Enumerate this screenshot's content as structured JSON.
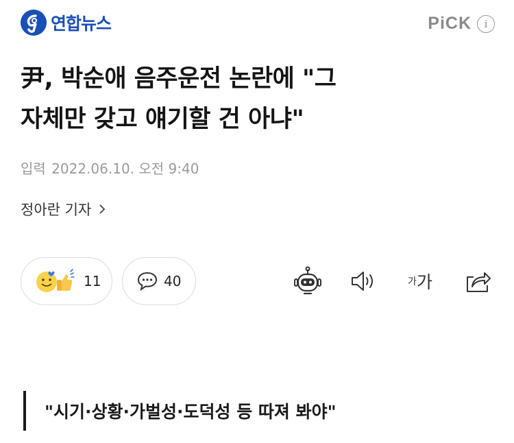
{
  "header": {
    "logo_text": "연합뉴스",
    "pick_label": "PiCK",
    "info_symbol": "i",
    "brand_color": "#1a4fb5"
  },
  "article": {
    "title_line1": "尹, 박순애 음주운전 논란에 \"그",
    "title_line2": "자체만 갖고 얘기할 건 아냐\"",
    "date_label": "입력",
    "date_value": "2022.06.10. 오전 9:40",
    "reporter": "정아란 기자",
    "subheading": "\"시기·상황·가벌성·도덕성 등 따져 봐야\""
  },
  "reactions": {
    "like_count": "11",
    "comment_count": "40"
  },
  "tools": {
    "font_small": "가",
    "font_large": "가"
  },
  "icons": {
    "reaction": "smile-thumbsup-icon",
    "comment": "speech-bubble-icon",
    "summary": "robot-icon",
    "tts": "speaker-icon",
    "share": "share-icon"
  }
}
